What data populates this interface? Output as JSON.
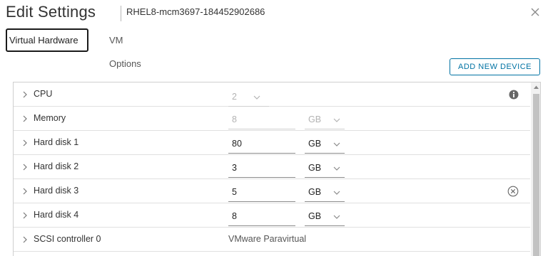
{
  "dialog": {
    "title": "Edit Settings",
    "vm_name": "RHEL8-mcm3697-184452902686"
  },
  "tabs": [
    {
      "label": "Virtual Hardware",
      "active": true
    },
    {
      "label": "VM Options",
      "active": false
    }
  ],
  "toolbar": {
    "add_device_label": "ADD NEW DEVICE"
  },
  "rows": {
    "cpu": {
      "label": "CPU",
      "value": "2"
    },
    "memory": {
      "label": "Memory",
      "value": "8",
      "unit": "GB"
    },
    "disk1": {
      "label": "Hard disk 1",
      "value": "80",
      "unit": "GB"
    },
    "disk2": {
      "label": "Hard disk 2",
      "value": "3",
      "unit": "GB"
    },
    "disk3": {
      "label": "Hard disk 3",
      "value": "5",
      "unit": "GB"
    },
    "disk4": {
      "label": "Hard disk 4",
      "value": "8",
      "unit": "GB"
    },
    "scsi": {
      "label": "SCSI controller 0",
      "value": "VMware Paravirtual"
    }
  },
  "icons": {
    "close": "close-icon",
    "expand": "chevron-right-icon",
    "dropdown": "chevron-down-icon",
    "info": "info-icon",
    "remove": "remove-circle-icon"
  },
  "colors": {
    "accent": "#0072a3",
    "disabled_text": "#b3b3b3"
  }
}
